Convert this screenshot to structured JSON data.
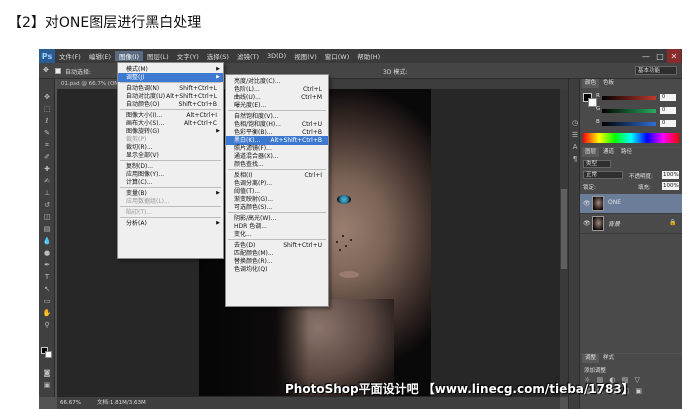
{
  "heading": "【2】对ONE图层进行黑白处理",
  "menubar": {
    "logo": "Ps",
    "items": [
      "文件(F)",
      "编辑(E)",
      "图像(I)",
      "图层(L)",
      "文字(Y)",
      "选择(S)",
      "滤镜(T)",
      "3D(D)",
      "视图(V)",
      "窗口(W)",
      "帮助(H)"
    ],
    "win_min": "—",
    "win_max": "□",
    "win_close": "✕"
  },
  "options": {
    "auto_select": "自动选择:",
    "mode3d": "3D 模式:",
    "workspace": "基本功能"
  },
  "doc_tab": "01.psd @ 66.7% (ONE, RGB/8)",
  "image_menu": [
    {
      "label": "模式(M)",
      "shortcut": "",
      "arrow": true
    },
    {
      "label": "调整(J)",
      "shortcut": "",
      "arrow": true,
      "hl": true
    },
    {
      "sep": true
    },
    {
      "label": "自动色调(N)",
      "shortcut": "Shift+Ctrl+L"
    },
    {
      "label": "自动对比度(U)",
      "shortcut": "Alt+Shift+Ctrl+L"
    },
    {
      "label": "自动颜色(O)",
      "shortcut": "Shift+Ctrl+B"
    },
    {
      "sep": true
    },
    {
      "label": "图像大小(I)...",
      "shortcut": "Alt+Ctrl+I"
    },
    {
      "label": "画布大小(S)...",
      "shortcut": "Alt+Ctrl+C"
    },
    {
      "label": "图像旋转(G)",
      "shortcut": "",
      "arrow": true
    },
    {
      "label": "裁剪(P)",
      "shortcut": "",
      "dis": true
    },
    {
      "label": "裁切(R)...",
      "shortcut": ""
    },
    {
      "label": "显示全部(V)",
      "shortcut": ""
    },
    {
      "sep": true
    },
    {
      "label": "复制(D)...",
      "shortcut": ""
    },
    {
      "label": "应用图像(Y)...",
      "shortcut": ""
    },
    {
      "label": "计算(C)...",
      "shortcut": ""
    },
    {
      "sep": true
    },
    {
      "label": "变量(B)",
      "shortcut": "",
      "arrow": true
    },
    {
      "label": "应用数据组(L)...",
      "shortcut": "",
      "dis": true
    },
    {
      "sep": true
    },
    {
      "label": "陷印(T)...",
      "shortcut": "",
      "dis": true
    },
    {
      "sep": true
    },
    {
      "label": "分析(A)",
      "shortcut": "",
      "arrow": true
    }
  ],
  "adjust_menu": [
    {
      "label": "亮度/对比度(C)...",
      "shortcut": ""
    },
    {
      "label": "色阶(L)...",
      "shortcut": "Ctrl+L"
    },
    {
      "label": "曲线(U)...",
      "shortcut": "Ctrl+M"
    },
    {
      "label": "曝光度(E)...",
      "shortcut": ""
    },
    {
      "sep": true
    },
    {
      "label": "自然饱和度(V)...",
      "shortcut": ""
    },
    {
      "label": "色相/饱和度(H)...",
      "shortcut": "Ctrl+U"
    },
    {
      "label": "色彩平衡(B)...",
      "shortcut": "Ctrl+B"
    },
    {
      "label": "黑白(K)...",
      "shortcut": "Alt+Shift+Ctrl+B",
      "hl": true
    },
    {
      "label": "照片滤镜(F)...",
      "shortcut": ""
    },
    {
      "label": "通道混合器(X)...",
      "shortcut": ""
    },
    {
      "label": "颜色查找...",
      "shortcut": ""
    },
    {
      "sep": true
    },
    {
      "label": "反相(I)",
      "shortcut": "Ctrl+I"
    },
    {
      "label": "色调分离(P)...",
      "shortcut": ""
    },
    {
      "label": "阈值(T)...",
      "shortcut": ""
    },
    {
      "label": "渐变映射(G)...",
      "shortcut": ""
    },
    {
      "label": "可选颜色(S)...",
      "shortcut": ""
    },
    {
      "sep": true
    },
    {
      "label": "阴影/高光(W)...",
      "shortcut": ""
    },
    {
      "label": "HDR 色调...",
      "shortcut": ""
    },
    {
      "label": "变化...",
      "shortcut": ""
    },
    {
      "sep": true
    },
    {
      "label": "去色(D)",
      "shortcut": "Shift+Ctrl+U"
    },
    {
      "label": "匹配颜色(M)...",
      "shortcut": ""
    },
    {
      "label": "替换颜色(R)...",
      "shortcut": ""
    },
    {
      "label": "色调均化(Q)",
      "shortcut": ""
    }
  ],
  "status": {
    "zoom": "66.67%",
    "doc": "文档:1.81M/3.63M"
  },
  "color_panel": {
    "tabs": [
      "颜色",
      "色板"
    ],
    "r_label": "R",
    "g_label": "G",
    "b_label": "B",
    "r_value": "0",
    "g_value": "0",
    "b_value": "0",
    "r_color": "#c0392b",
    "g_color": "#27ae60",
    "b_color": "#2e6fd8"
  },
  "layers_panel": {
    "tabs": [
      "图层",
      "通道",
      "路径"
    ],
    "kind": "类型",
    "blend_mode": "正常",
    "opacity_label": "不透明度:",
    "opacity_value": "100%",
    "lock_label": "锁定:",
    "fill_label": "填充:",
    "fill_value": "100%",
    "layers": [
      {
        "name": "ONE",
        "selected": true
      },
      {
        "name": "背景",
        "selected": false
      }
    ]
  },
  "adjust_panel": {
    "tabs": [
      "调整",
      "样式"
    ],
    "title": "添加调整"
  },
  "watermark": "PhotoShop平面设计吧 【www.linecg.com/tieba/1783】"
}
